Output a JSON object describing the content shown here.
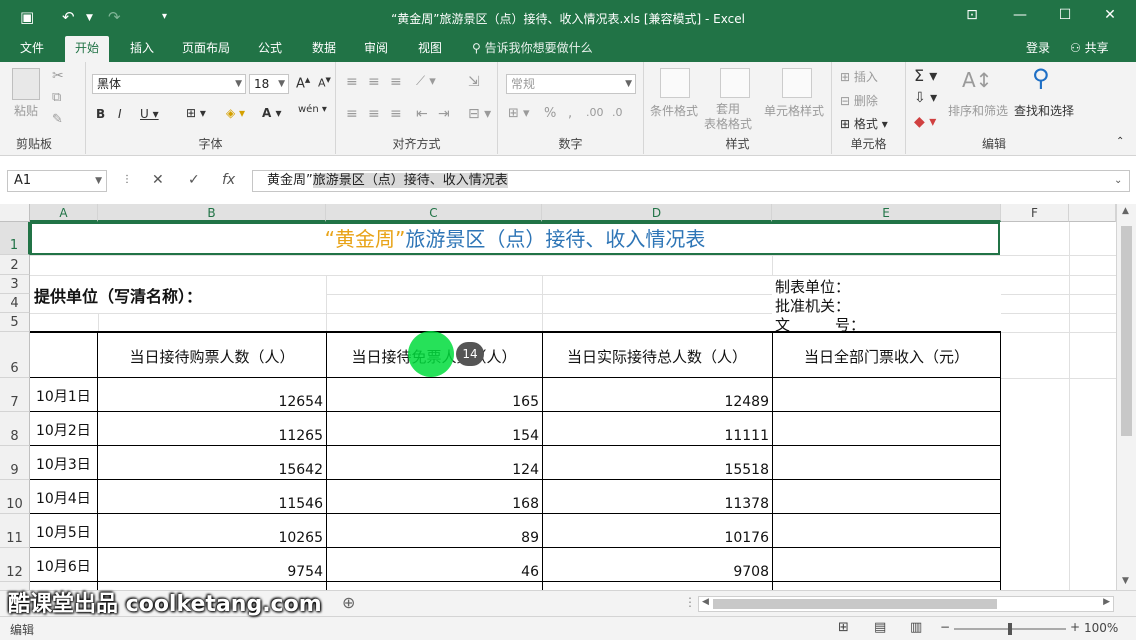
{
  "window": {
    "title": "“黄金周”旅游景区（点）接待、收入情况表.xls  [兼容模式] - Excel"
  },
  "menu": {
    "tabs": [
      "文件",
      "开始",
      "插入",
      "页面布局",
      "公式",
      "数据",
      "审阅",
      "视图"
    ],
    "tell_me": "告诉我你想要做什么",
    "login": "登录",
    "share": "共享"
  },
  "ribbon": {
    "clipboard": {
      "paste": "粘贴",
      "label": "剪贴板"
    },
    "font": {
      "name": "黑体",
      "size": "18",
      "label": "字体"
    },
    "alignment": {
      "label": "对齐方式"
    },
    "number": {
      "format": "常规",
      "label": "数字"
    },
    "styles": {
      "conditional": "条件格式",
      "table": "套用\n表格格式",
      "cell_styles": "单元格样式",
      "label": "样式"
    },
    "cells": {
      "insert": "插入",
      "delete": "删除",
      "format": "格式",
      "label": "单元格"
    },
    "editing": {
      "sort": "排序和筛选",
      "find": "查找和选择",
      "label": "编辑"
    }
  },
  "formula_bar": {
    "name_box": "A1",
    "content_plain": "黄金周”",
    "content_selected": "旅游景区（点）接待、收入情况表"
  },
  "columns": [
    "A",
    "B",
    "C",
    "D",
    "E",
    "F"
  ],
  "rows": [
    "1",
    "2",
    "3",
    "4",
    "5",
    "6",
    "7",
    "8",
    "9",
    "10",
    "11",
    "12"
  ],
  "sheet": {
    "title_part1": "“黄金周”",
    "title_part2": "旅游景区（点）接待、收入情况表",
    "provider": "提供单位（写清名称）：",
    "maker": "制表单位：",
    "approver": "批准机关：",
    "doc_no": "文　　　号：",
    "headers": [
      "当日接待购票人数（人）",
      "当日接待免票人数（人）",
      "当日实际接待总人数（人）",
      "当日全部门票收入（元）"
    ],
    "data": [
      {
        "date": "10月1日",
        "paid": "12654",
        "free": "165",
        "total": "12489",
        "revenue": ""
      },
      {
        "date": "10月2日",
        "paid": "11265",
        "free": "154",
        "total": "11111",
        "revenue": ""
      },
      {
        "date": "10月3日",
        "paid": "15642",
        "free": "124",
        "total": "15518",
        "revenue": ""
      },
      {
        "date": "10月4日",
        "paid": "11546",
        "free": "168",
        "total": "11378",
        "revenue": ""
      },
      {
        "date": "10月5日",
        "paid": "10265",
        "free": "89",
        "total": "10176",
        "revenue": ""
      },
      {
        "date": "10月6日",
        "paid": "9754",
        "free": "46",
        "total": "9708",
        "revenue": ""
      }
    ]
  },
  "status": {
    "mode": "编辑",
    "zoom": "100%"
  },
  "overlay": {
    "watermark": "酷课堂出品 coolketang.com",
    "click_count": "14"
  },
  "colors": {
    "excel_green": "#217346",
    "title_gold": "#e8a317",
    "title_blue": "#2e75b6"
  }
}
